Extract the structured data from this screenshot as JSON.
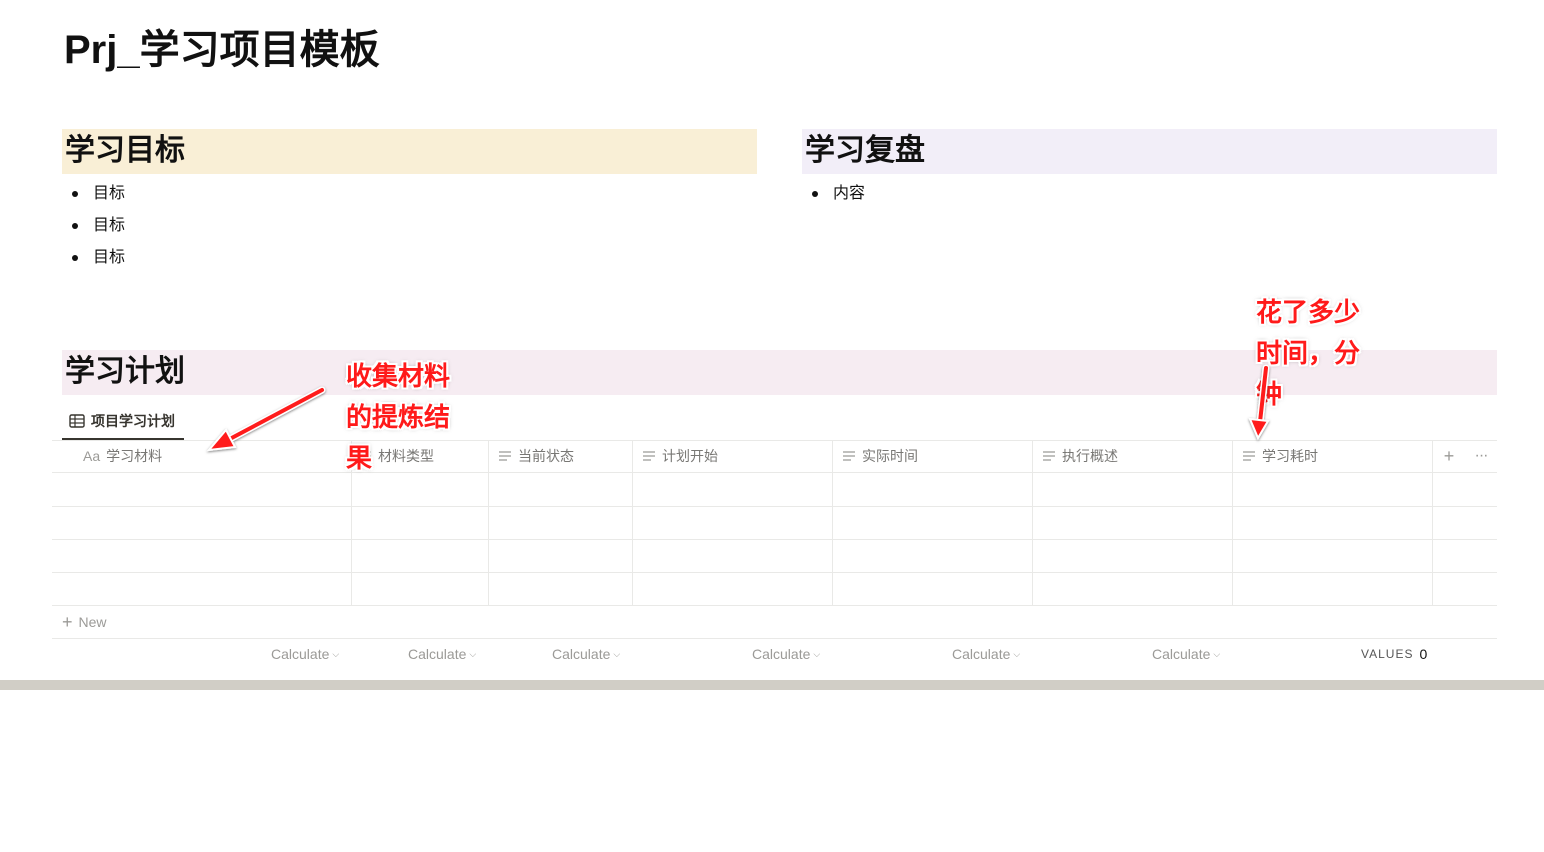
{
  "page": {
    "title": "Prj_学习项目模板"
  },
  "goals": {
    "heading": "学习目标",
    "items": [
      "目标",
      "目标",
      "目标"
    ],
    "bg_color": "#f9efd6"
  },
  "review": {
    "heading": "学习复盘",
    "items": [
      "内容"
    ],
    "bg_color": "#f2eef8"
  },
  "plan": {
    "heading": "学习计划",
    "bg_color": "#f6ecf2",
    "view_tab": {
      "label": "项目学习计划",
      "icon": "table-icon"
    },
    "columns": [
      {
        "label": "学习材料",
        "icon": "title-aa-icon",
        "icon_text": "Aa"
      },
      {
        "label": "材料类型",
        "icon": "text-lines-icon"
      },
      {
        "label": "当前状态",
        "icon": "text-lines-icon"
      },
      {
        "label": "计划开始",
        "icon": "text-lines-icon"
      },
      {
        "label": "实际时间",
        "icon": "text-lines-icon"
      },
      {
        "label": "执行概述",
        "icon": "text-lines-icon"
      },
      {
        "label": "学习耗时",
        "icon": "text-lines-icon"
      }
    ],
    "add_column_glyph": "+",
    "more_glyph": "···",
    "row_count": 4,
    "new_row": {
      "plus": "+",
      "label": "New"
    },
    "calculate": {
      "label": "Calculate",
      "chevron": "⌵",
      "count": 6
    },
    "values": {
      "label": "VALUES",
      "count": "0"
    }
  },
  "annotations": {
    "left": "收集材料\n的提炼结\n果",
    "right": "花了多少\n时间，分\n钟",
    "color": "#ff1a1a"
  }
}
